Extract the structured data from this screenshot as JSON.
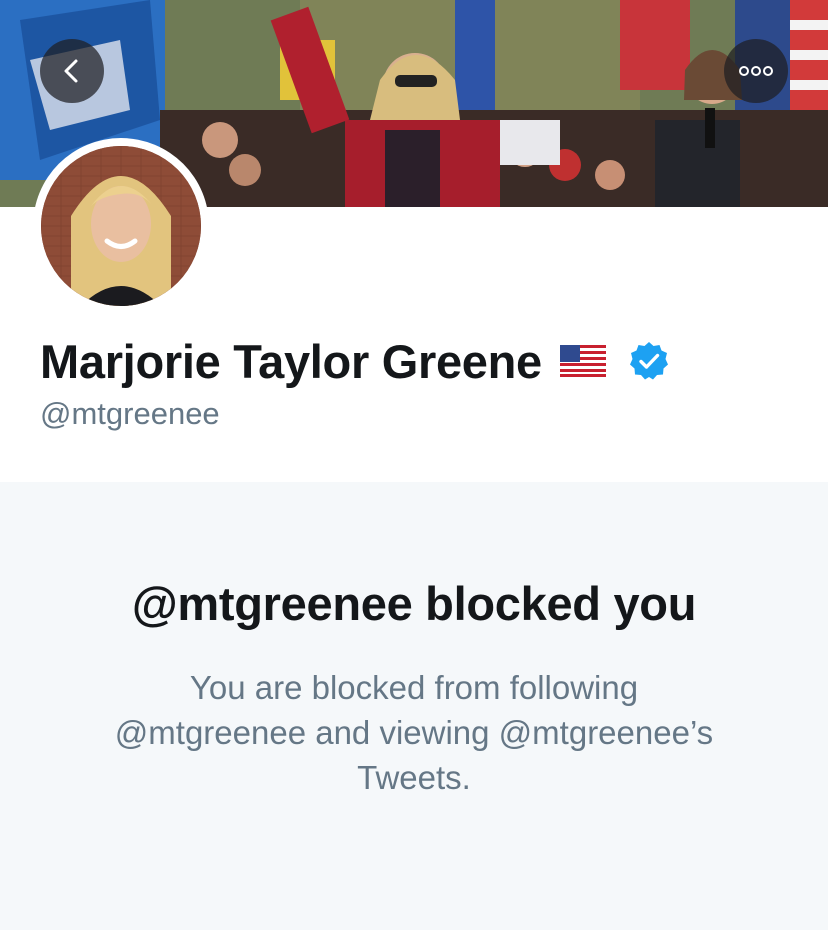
{
  "profile": {
    "name": "Marjorie Taylor Greene",
    "handle": "@mtgreenee",
    "flag_icon": "us-flag-emoji",
    "verified_icon": "verified-badge-icon"
  },
  "nav": {
    "back_icon": "chevron-left-icon",
    "more_icon": "more-dots-icon"
  },
  "blocked": {
    "title": "@mtgreenee blocked you",
    "description": "You are blocked from following @mtgreenee and viewing @mtgreenee’s Tweets."
  },
  "colors": {
    "verified": "#1da1f2",
    "primary_text": "#14171a",
    "secondary_text": "#657786",
    "panel_bg": "#f5f8fa"
  }
}
